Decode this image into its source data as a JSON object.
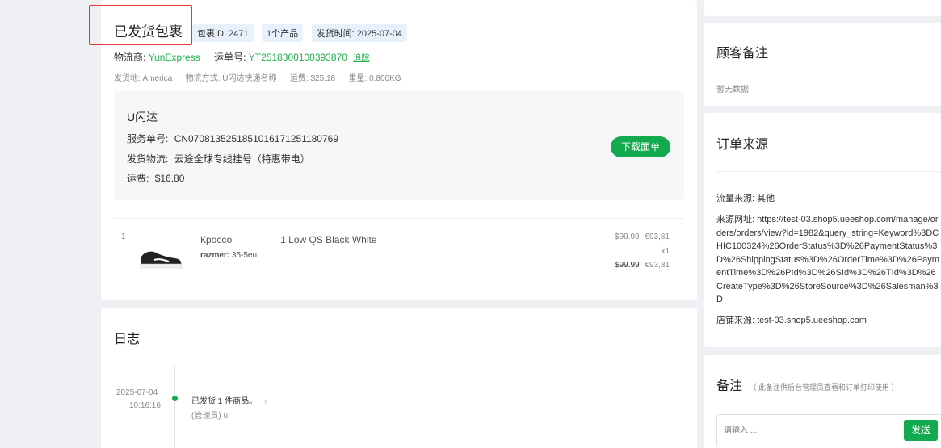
{
  "package": {
    "title": "已发货包裹",
    "tags": [
      "包裹ID: 2471",
      "1个产品",
      "发货时间: 2025-07-04"
    ],
    "carrier_label": "物流商:",
    "carrier_value": "YunExpress",
    "tracking_label": "运单号:",
    "tracking_value": "YT2518300100393870",
    "track_link": "追踪",
    "meta": [
      "发货地: America",
      "物流方式: U闪达快递名称",
      "运费: $25.18",
      "重量: 0.800KG"
    ]
  },
  "service": {
    "name": "U闪达",
    "service_no_label": "服务单号:",
    "service_no": "CN0708135251851016171251180769",
    "logistics_label": "发货物流:",
    "logistics": "云途全球专线挂号（特惠带电）",
    "fee_label": "运费:",
    "fee": "$16.80",
    "download_button": "下载面单"
  },
  "product": {
    "index": "1",
    "name": "Кроссо     1 Low QS Black White",
    "attr_label": "razmer:",
    "attr_value": "35-5eu",
    "unit_price": "$99.99",
    "unit_price_alt": "€93,81",
    "qty": "x1",
    "total_price": "$99.99",
    "total_price_alt": "€93,81"
  },
  "log": {
    "title": "日志",
    "entries": [
      {
        "date": "2025-07-04",
        "time": "10:16:16",
        "text": "已发货 1 件商品。",
        "sub": "(管理员) u"
      }
    ]
  },
  "customer_note": {
    "title": "顾客备注",
    "empty": "暂无数据"
  },
  "order_source": {
    "title": "订单来源",
    "traffic_label": "流量来源:",
    "traffic_value": "其他",
    "url_label": "来源网址:",
    "url_value": "https://test-03.shop5.ueeshop.com/manage/orders/orders/view?id=1982&query_string=Keyword%3DCHIC100324%26OrderStatus%3D%26PaymentStatus%3D%26ShippingStatus%3D%26OrderTime%3D%26PaymentTime%3D%26PId%3D%26SId%3D%26TId%3D%26CreateType%3D%26StoreSource%3D%26Salesman%3D",
    "store_label": "店铺来源:",
    "store_value": "test-03.shop5.ueeshop.com"
  },
  "remark": {
    "title": "备注",
    "hint": "（ 此备注供后台管理员查看和订单打印使用 ）",
    "placeholder": "请输入 ...",
    "send_button": "发送"
  },
  "colors": {
    "accent": "#13a94e",
    "highlight_border": "#e53935"
  }
}
